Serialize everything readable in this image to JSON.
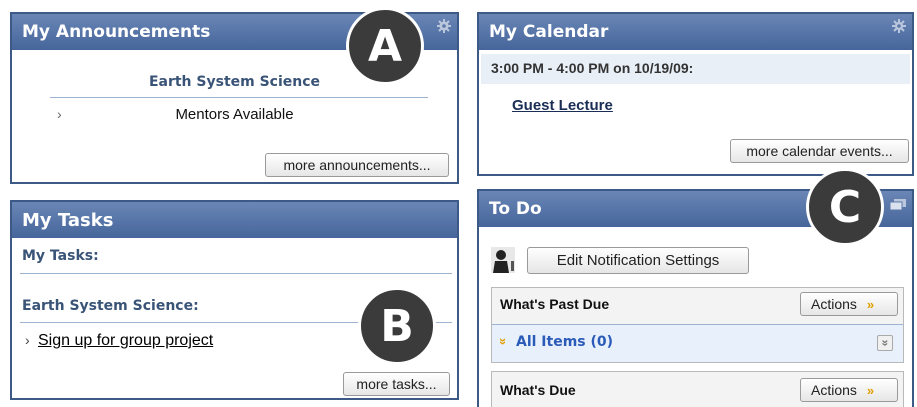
{
  "announcements": {
    "title": "My Announcements",
    "course": "Earth System Science",
    "items": [
      {
        "label": "Mentors Available",
        "bullet": "›"
      }
    ],
    "more_label": "more announcements..."
  },
  "calendar": {
    "title": "My Calendar",
    "event_time": "3:00 PM - 4:00 PM on 10/19/09:",
    "event_name": "Guest Lecture",
    "more_label": "more calendar events..."
  },
  "tasks": {
    "title": "My Tasks",
    "subtitle": "My Tasks:",
    "course": "Earth System Science:",
    "items": [
      {
        "label": "Sign up for group project",
        "bullet": "›"
      }
    ],
    "more_label": "more tasks..."
  },
  "todo": {
    "title": "To Do",
    "edit_notifications_label": "Edit Notification Settings",
    "past_due": {
      "title": "What's Past Due",
      "actions_label": "Actions",
      "all_items_label": "All Items (0)"
    },
    "due": {
      "title": "What's Due",
      "actions_label": "Actions"
    }
  },
  "callouts": {
    "a": "A",
    "b": "B",
    "c": "C"
  },
  "icons": {
    "module_options": "gear-icon",
    "detach": "detach-icon",
    "actions_chevron": "double-chevron-down-icon",
    "collapse": "double-chevron-down-icon",
    "avatar": "person-avatar"
  },
  "colors": {
    "header_start": "#6a86b6",
    "header_end": "#46659a",
    "module_border": "#3d5a86",
    "course_heading": "#3a5478",
    "accent_chevron": "#e0a000",
    "all_items_bg": "#e7f0fb"
  }
}
